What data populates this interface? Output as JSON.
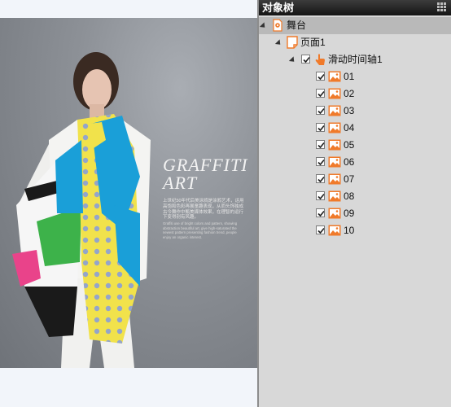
{
  "poster": {
    "headline_line1": "GRAFFITI",
    "headline_line2": "ART",
    "caption_cn": "上世纪50年代后美涂鸦是涂鸦艺术，运用高饱和色彩再展童趣表现，从而头饰独成古今舞作中甄美媒体效果，在理智的运行下变得别有风趣。",
    "caption_en": "Graffiti use of bright colors and pattern, showing abstraction beautiful art, give high-saturated the newest pattern presenting fashion trend, people enjoy an organic interest."
  },
  "panel": {
    "title": "对象树",
    "tree": [
      {
        "label": "舞台",
        "icon": "stage-icon",
        "expanded": true,
        "selected": true
      },
      {
        "label": "页面1",
        "icon": "page-icon",
        "expanded": true
      },
      {
        "label": "滑动时间轴1",
        "icon": "timeline-icon",
        "expanded": true,
        "checked": true
      },
      {
        "label": "01",
        "icon": "image-icon",
        "checked": true
      },
      {
        "label": "02",
        "icon": "image-icon",
        "checked": true
      },
      {
        "label": "03",
        "icon": "image-icon",
        "checked": true
      },
      {
        "label": "04",
        "icon": "image-icon",
        "checked": true
      },
      {
        "label": "05",
        "icon": "image-icon",
        "checked": true
      },
      {
        "label": "06",
        "icon": "image-icon",
        "checked": true
      },
      {
        "label": "07",
        "icon": "image-icon",
        "checked": true
      },
      {
        "label": "08",
        "icon": "image-icon",
        "checked": true
      },
      {
        "label": "09",
        "icon": "image-icon",
        "checked": true
      },
      {
        "label": "10",
        "icon": "image-icon",
        "checked": true
      }
    ]
  },
  "colors": {
    "panel_bg": "#d8d8d8",
    "header_bg": "#1e1e1e",
    "selected_row": "#b9b9b9",
    "icon_orange": "#f07a2a"
  }
}
